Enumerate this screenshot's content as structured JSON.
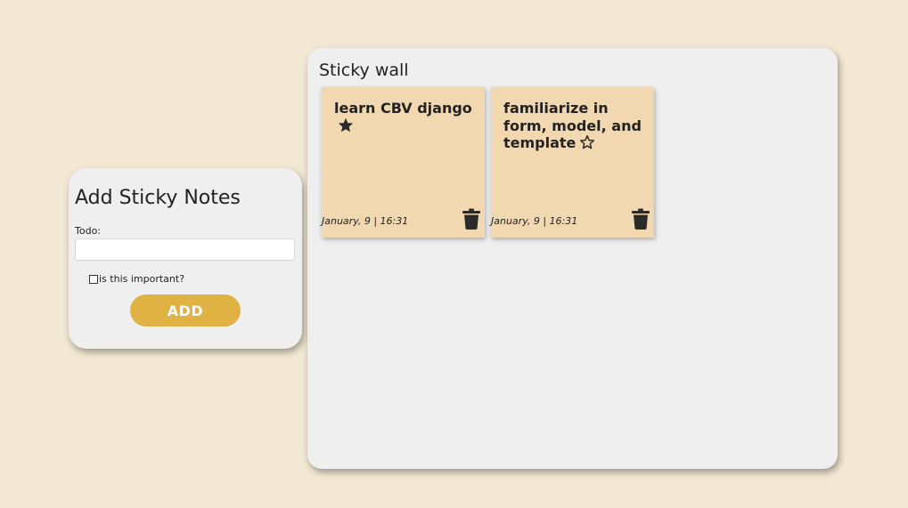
{
  "form": {
    "title": "Add Sticky Notes",
    "todo_label": "Todo:",
    "todo_value": "",
    "important_label": "is this important?",
    "important_checked": false,
    "add_label": "ADD"
  },
  "wall": {
    "title": "Sticky wall",
    "notes": [
      {
        "text": "learn CBV django",
        "important": true,
        "date": "January, 9 | 16:31"
      },
      {
        "text": "familiarize in form, model, and template",
        "important": false,
        "date": "January, 9 | 16:31"
      }
    ]
  },
  "icons": {
    "important_star": "star-filled-icon",
    "normal_star": "star-outline-icon",
    "delete": "trash-icon"
  },
  "colors": {
    "background": "#f2e8d3",
    "panel": "#efefef",
    "note": "#f2d8b0",
    "accent": "#dfb243"
  }
}
